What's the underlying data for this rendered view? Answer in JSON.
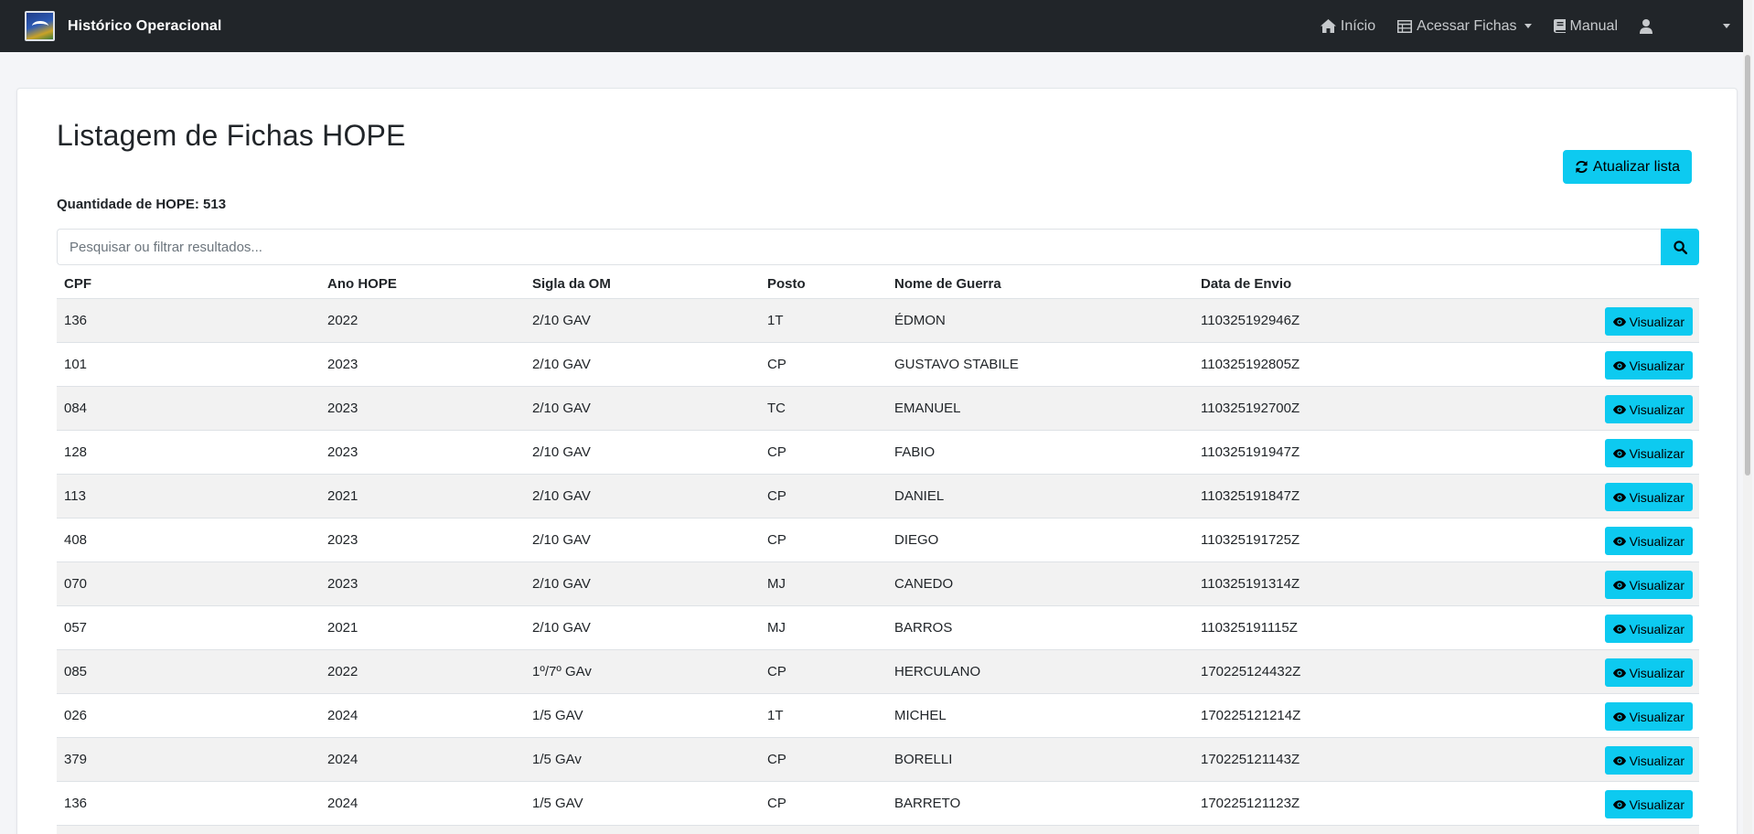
{
  "app": {
    "title": "Histórico Operacional"
  },
  "nav": {
    "home_label": "Início",
    "fichas_label": "Acessar Fichas",
    "manual_label": "Manual"
  },
  "page": {
    "title": "Listagem de Fichas HOPE",
    "refresh_label": "Atualizar lista",
    "count_label": "Quantidade de HOPE: 513"
  },
  "search": {
    "placeholder": "Pesquisar ou filtrar resultados..."
  },
  "table": {
    "headers": [
      "CPF",
      "Ano HOPE",
      "Sigla da OM",
      "Posto",
      "Nome de Guerra",
      "Data de Envio"
    ],
    "view_label": "Visualizar",
    "rows": [
      {
        "cpf": "136",
        "ano": "2022",
        "om": "2/10 GAV",
        "posto": "1T",
        "nome": "ÉDMON",
        "data": "110325192946Z"
      },
      {
        "cpf": "101",
        "ano": "2023",
        "om": "2/10 GAV",
        "posto": "CP",
        "nome": "GUSTAVO STABILE",
        "data": "110325192805Z"
      },
      {
        "cpf": "084",
        "ano": "2023",
        "om": "2/10 GAV",
        "posto": "TC",
        "nome": "EMANUEL",
        "data": "110325192700Z"
      },
      {
        "cpf": "128",
        "ano": "2023",
        "om": "2/10 GAV",
        "posto": "CP",
        "nome": "FABIO",
        "data": "110325191947Z"
      },
      {
        "cpf": "113",
        "ano": "2021",
        "om": "2/10 GAV",
        "posto": "CP",
        "nome": "DANIEL",
        "data": "110325191847Z"
      },
      {
        "cpf": "408",
        "ano": "2023",
        "om": "2/10 GAV",
        "posto": "CP",
        "nome": "DIEGO",
        "data": "110325191725Z"
      },
      {
        "cpf": "070",
        "ano": "2023",
        "om": "2/10 GAV",
        "posto": "MJ",
        "nome": "CANEDO",
        "data": "110325191314Z"
      },
      {
        "cpf": "057",
        "ano": "2021",
        "om": "2/10 GAV",
        "posto": "MJ",
        "nome": "BARROS",
        "data": "110325191115Z"
      },
      {
        "cpf": "085",
        "ano": "2022",
        "om": "1º/7º GAv",
        "posto": "CP",
        "nome": "HERCULANO",
        "data": "170225124432Z"
      },
      {
        "cpf": "026",
        "ano": "2024",
        "om": "1/5 GAV",
        "posto": "1T",
        "nome": "MICHEL",
        "data": "170225121214Z"
      },
      {
        "cpf": "379",
        "ano": "2024",
        "om": "1/5 GAv",
        "posto": "CP",
        "nome": "BORELLI",
        "data": "170225121143Z"
      },
      {
        "cpf": "136",
        "ano": "2024",
        "om": "1/5 GAV",
        "posto": "CP",
        "nome": "BARRETO",
        "data": "170225121123Z"
      },
      {
        "cpf": "",
        "ano": "",
        "om": "",
        "posto": "",
        "nome": "",
        "data": ""
      }
    ]
  },
  "colors": {
    "navbar": "#212529",
    "accent": "#0dcaf0",
    "stripe": "#f2f2f2"
  },
  "icons": [
    "home-icon",
    "table-icon",
    "book-icon",
    "user-icon",
    "refresh-icon",
    "search-icon",
    "eye-icon"
  ]
}
